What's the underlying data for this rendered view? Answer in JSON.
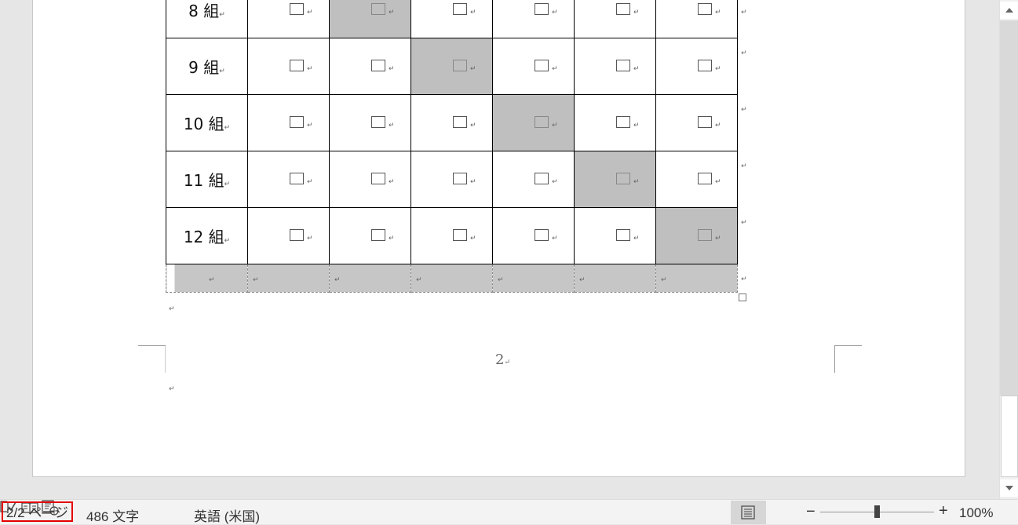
{
  "document": {
    "rows": [
      {
        "label": "8 組",
        "shaded_col": 2
      },
      {
        "label": "9 組",
        "shaded_col": 3
      },
      {
        "label": "10 組",
        "shaded_col": 4
      },
      {
        "label": "11 組",
        "shaded_col": 5
      },
      {
        "label": "12 組",
        "shaded_col": 6
      }
    ],
    "data_columns": 6,
    "paragraph_mark": "↵",
    "page_number": "2"
  },
  "statusbar": {
    "page_count": "2/2 ページ",
    "word_count": "486 文字",
    "language": "英語 (米国)",
    "zoom_minus": "−",
    "zoom_plus": "+",
    "zoom_level": "100%"
  },
  "colors": {
    "shade": "#bfbfbf",
    "highlight_border": "#e60000"
  }
}
